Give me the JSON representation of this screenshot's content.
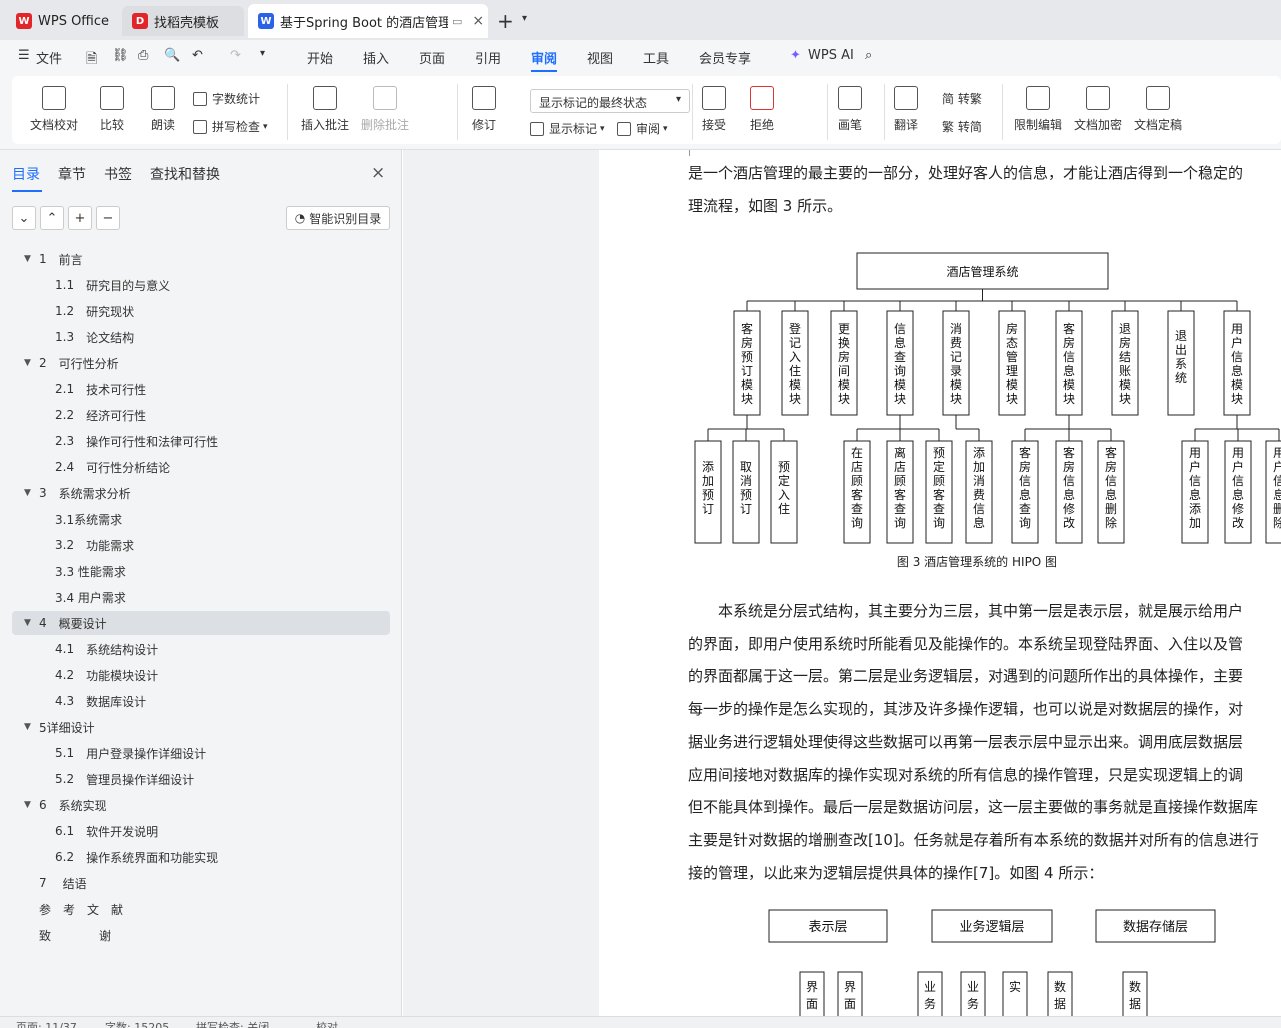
{
  "tabs": [
    {
      "label": "WPS Office"
    },
    {
      "label": "找稻壳模板"
    },
    {
      "label": "基于Spring Boot 的酒店管理"
    }
  ],
  "menu": {
    "file": "文件",
    "items": [
      "开始",
      "插入",
      "页面",
      "引用",
      "审阅",
      "视图",
      "工具",
      "会员专享"
    ],
    "active": "审阅",
    "ai": "WPS AI"
  },
  "ribbon": {
    "doc_check": "文档校对",
    "compare": "比较",
    "read": "朗读",
    "word_count": "字数统计",
    "spell_check": "拼写检查",
    "insert_comment": "插入批注",
    "delete_comment": "删除批注",
    "revise": "修订",
    "markup_state": "显示标记的最终状态",
    "show_markup": "显示标记",
    "review": "审阅",
    "accept": "接受",
    "reject": "拒绝",
    "pen": "画笔",
    "translate": "翻译",
    "to_traditional": "繁 转简",
    "to_simplified": "简 转繁",
    "restrict_edit": "限制编辑",
    "doc_encrypt": "文档加密",
    "doc_final": "文档定稿"
  },
  "sidebar": {
    "tabs": [
      "目录",
      "章节",
      "书签",
      "查找和替换"
    ],
    "smart_toc": "智能识别目录",
    "toc": [
      {
        "num": "1",
        "label": "前言",
        "level": 1
      },
      {
        "num": "1.1",
        "label": "研究目的与意义",
        "level": 2
      },
      {
        "num": "1.2",
        "label": "研究现状",
        "level": 2
      },
      {
        "num": "1.3",
        "label": "论文结构",
        "level": 2
      },
      {
        "num": "2",
        "label": "可行性分析",
        "level": 1
      },
      {
        "num": "2.1",
        "label": "技术可行性",
        "level": 2
      },
      {
        "num": "2.2",
        "label": "经济可行性",
        "level": 2
      },
      {
        "num": "2.3",
        "label": "操作可行性和法律可行性",
        "level": 2
      },
      {
        "num": "2.4",
        "label": "可行性分析结论",
        "level": 2
      },
      {
        "num": "3",
        "label": "系统需求分析",
        "level": 1
      },
      {
        "num": "",
        "label": "3.1系统需求",
        "level": 2
      },
      {
        "num": "3.2",
        "label": "功能需求",
        "level": 2
      },
      {
        "num": "",
        "label": "3.3 性能需求",
        "level": 2
      },
      {
        "num": "",
        "label": "3.4 用户需求",
        "level": 2
      },
      {
        "num": "4",
        "label": "概要设计",
        "level": 1
      },
      {
        "num": "4.1",
        "label": "系统结构设计",
        "level": 2
      },
      {
        "num": "4.2",
        "label": "功能模块设计",
        "level": 2
      },
      {
        "num": "4.3",
        "label": "数据库设计",
        "level": 2
      },
      {
        "num": "",
        "label": "5详细设计",
        "level": 1
      },
      {
        "num": "5.1",
        "label": "用户登录操作详细设计",
        "level": 2
      },
      {
        "num": "5.2",
        "label": "管理员操作详细设计",
        "level": 2
      },
      {
        "num": "6",
        "label": "系统实现",
        "level": 1
      },
      {
        "num": "6.1",
        "label": "软件开发说明",
        "level": 2
      },
      {
        "num": "6.2",
        "label": "操作系统界面和功能实现",
        "level": 2
      },
      {
        "num": "7",
        "label": "结语",
        "level": 0
      },
      {
        "num": "",
        "label": "参　考　文　献",
        "level": 0
      },
      {
        "num": "",
        "label": "致　　　　谢",
        "level": 0
      }
    ]
  },
  "doc": {
    "line1": "是一个酒店管理的最主要的一部分，处理好客人的信息，才能让酒店得到一个稳定的",
    "line2": "理流程，如图 3 所示。",
    "fig3": {
      "root": "酒店管理系统",
      "modules": [
        "客房预订模块",
        "登记入住模块",
        "更换房间模块",
        "信息查询模块",
        "消费记录模块",
        "房态管理模块",
        "客房信息模块",
        "退房结账模块",
        "退出系统",
        "用户信息模块"
      ],
      "subs": [
        "添加预订",
        "取消预订",
        "预定入住",
        "在店顾客查询",
        "离店顾客查询",
        "预定顾客查询",
        "添加消费信息",
        "客房信息查询",
        "客房信息修改",
        "客房信息删除",
        "用户信息添加",
        "用户信息修改",
        "用户信息删除"
      ],
      "caption": "图 3  酒店管理系统的 HIPO 图"
    },
    "para": [
      "　　本系统是分层式结构，其主要分为三层，其中第一层是表示层，就是展示给用户",
      "的界面，即用户使用系统时所能看见及能操作的。本系统呈现登陆界面、入住以及管",
      "的界面都属于这一层。第二层是业务逻辑层，对遇到的问题所作出的具体操作，主要",
      "每一步的操作是怎么实现的，其涉及许多操作逻辑，也可以说是对数据层的操作，对",
      "据业务进行逻辑处理使得这些数据可以再第一层表示层中显示出来。调用底层数据层",
      "应用间接地对数据库的操作实现对系统的所有信息的操作管理，只是实现逻辑上的调",
      "但不能具体到操作。最后一层是数据访问层，这一层主要做的事务就是直接操作数据库",
      "主要是针对数据的增删查改[10]。任务就是存着所有本系统的数据并对所有的信息进行",
      "接的管理，以此来为逻辑层提供具体的操作[7]。如图 4 所示："
    ],
    "fig4": {
      "layers": [
        "表示层",
        "业务逻辑层",
        "数据存储层"
      ],
      "stubs": [
        "界面",
        "界面",
        "业务",
        "业务",
        "实",
        "数据",
        "数据"
      ]
    }
  },
  "status": {
    "page": "页面: 11/37",
    "words": "字数: 15205",
    "spell": "拼写检查: 关闭",
    "proof": "校对"
  }
}
